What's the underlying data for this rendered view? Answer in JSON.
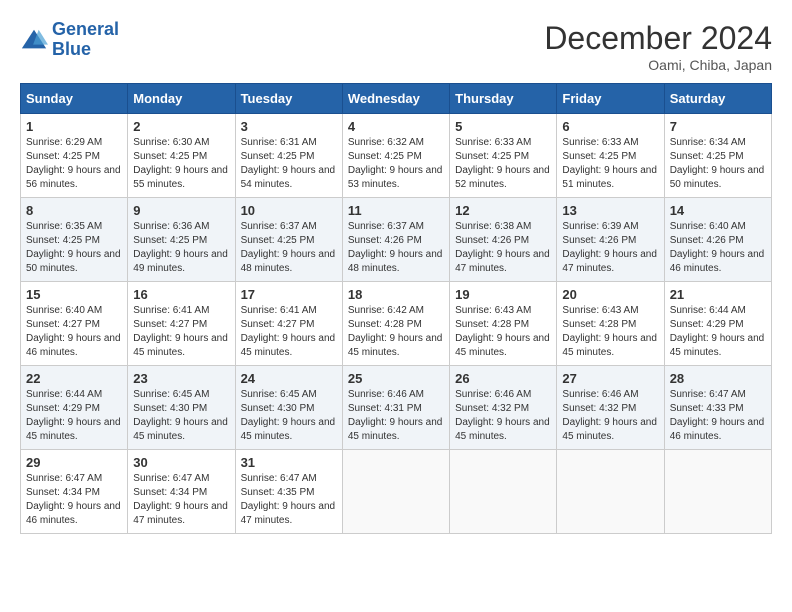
{
  "logo": {
    "line1": "General",
    "line2": "Blue"
  },
  "title": "December 2024",
  "subtitle": "Oami, Chiba, Japan",
  "days_of_week": [
    "Sunday",
    "Monday",
    "Tuesday",
    "Wednesday",
    "Thursday",
    "Friday",
    "Saturday"
  ],
  "weeks": [
    [
      {
        "day": "1",
        "sunrise": "6:29 AM",
        "sunset": "4:25 PM",
        "daylight": "9 hours and 56 minutes."
      },
      {
        "day": "2",
        "sunrise": "6:30 AM",
        "sunset": "4:25 PM",
        "daylight": "9 hours and 55 minutes."
      },
      {
        "day": "3",
        "sunrise": "6:31 AM",
        "sunset": "4:25 PM",
        "daylight": "9 hours and 54 minutes."
      },
      {
        "day": "4",
        "sunrise": "6:32 AM",
        "sunset": "4:25 PM",
        "daylight": "9 hours and 53 minutes."
      },
      {
        "day": "5",
        "sunrise": "6:33 AM",
        "sunset": "4:25 PM",
        "daylight": "9 hours and 52 minutes."
      },
      {
        "day": "6",
        "sunrise": "6:33 AM",
        "sunset": "4:25 PM",
        "daylight": "9 hours and 51 minutes."
      },
      {
        "day": "7",
        "sunrise": "6:34 AM",
        "sunset": "4:25 PM",
        "daylight": "9 hours and 50 minutes."
      }
    ],
    [
      {
        "day": "8",
        "sunrise": "6:35 AM",
        "sunset": "4:25 PM",
        "daylight": "9 hours and 50 minutes."
      },
      {
        "day": "9",
        "sunrise": "6:36 AM",
        "sunset": "4:25 PM",
        "daylight": "9 hours and 49 minutes."
      },
      {
        "day": "10",
        "sunrise": "6:37 AM",
        "sunset": "4:25 PM",
        "daylight": "9 hours and 48 minutes."
      },
      {
        "day": "11",
        "sunrise": "6:37 AM",
        "sunset": "4:26 PM",
        "daylight": "9 hours and 48 minutes."
      },
      {
        "day": "12",
        "sunrise": "6:38 AM",
        "sunset": "4:26 PM",
        "daylight": "9 hours and 47 minutes."
      },
      {
        "day": "13",
        "sunrise": "6:39 AM",
        "sunset": "4:26 PM",
        "daylight": "9 hours and 47 minutes."
      },
      {
        "day": "14",
        "sunrise": "6:40 AM",
        "sunset": "4:26 PM",
        "daylight": "9 hours and 46 minutes."
      }
    ],
    [
      {
        "day": "15",
        "sunrise": "6:40 AM",
        "sunset": "4:27 PM",
        "daylight": "9 hours and 46 minutes."
      },
      {
        "day": "16",
        "sunrise": "6:41 AM",
        "sunset": "4:27 PM",
        "daylight": "9 hours and 45 minutes."
      },
      {
        "day": "17",
        "sunrise": "6:41 AM",
        "sunset": "4:27 PM",
        "daylight": "9 hours and 45 minutes."
      },
      {
        "day": "18",
        "sunrise": "6:42 AM",
        "sunset": "4:28 PM",
        "daylight": "9 hours and 45 minutes."
      },
      {
        "day": "19",
        "sunrise": "6:43 AM",
        "sunset": "4:28 PM",
        "daylight": "9 hours and 45 minutes."
      },
      {
        "day": "20",
        "sunrise": "6:43 AM",
        "sunset": "4:28 PM",
        "daylight": "9 hours and 45 minutes."
      },
      {
        "day": "21",
        "sunrise": "6:44 AM",
        "sunset": "4:29 PM",
        "daylight": "9 hours and 45 minutes."
      }
    ],
    [
      {
        "day": "22",
        "sunrise": "6:44 AM",
        "sunset": "4:29 PM",
        "daylight": "9 hours and 45 minutes."
      },
      {
        "day": "23",
        "sunrise": "6:45 AM",
        "sunset": "4:30 PM",
        "daylight": "9 hours and 45 minutes."
      },
      {
        "day": "24",
        "sunrise": "6:45 AM",
        "sunset": "4:30 PM",
        "daylight": "9 hours and 45 minutes."
      },
      {
        "day": "25",
        "sunrise": "6:46 AM",
        "sunset": "4:31 PM",
        "daylight": "9 hours and 45 minutes."
      },
      {
        "day": "26",
        "sunrise": "6:46 AM",
        "sunset": "4:32 PM",
        "daylight": "9 hours and 45 minutes."
      },
      {
        "day": "27",
        "sunrise": "6:46 AM",
        "sunset": "4:32 PM",
        "daylight": "9 hours and 45 minutes."
      },
      {
        "day": "28",
        "sunrise": "6:47 AM",
        "sunset": "4:33 PM",
        "daylight": "9 hours and 46 minutes."
      }
    ],
    [
      {
        "day": "29",
        "sunrise": "6:47 AM",
        "sunset": "4:34 PM",
        "daylight": "9 hours and 46 minutes."
      },
      {
        "day": "30",
        "sunrise": "6:47 AM",
        "sunset": "4:34 PM",
        "daylight": "9 hours and 47 minutes."
      },
      {
        "day": "31",
        "sunrise": "6:47 AM",
        "sunset": "4:35 PM",
        "daylight": "9 hours and 47 minutes."
      },
      null,
      null,
      null,
      null
    ]
  ]
}
